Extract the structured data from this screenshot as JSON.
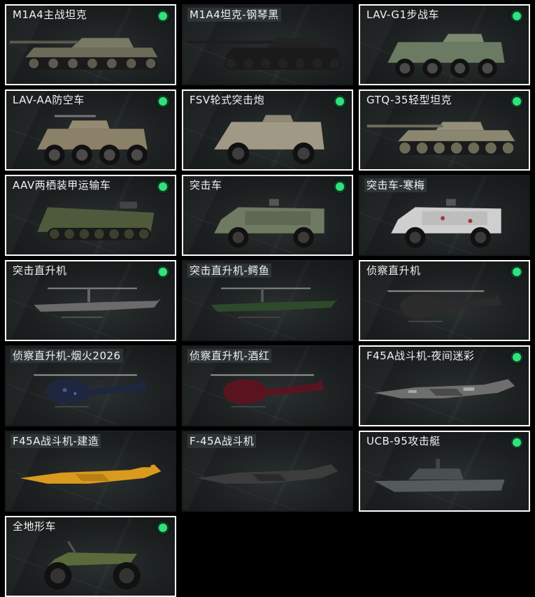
{
  "colors": {
    "owned_border": "#ffffff",
    "badge": "#34e07a",
    "background": "#000000",
    "card_bg": "#1b1f20"
  },
  "vehicles": [
    {
      "label": "M1A4主战坦克",
      "owned": true,
      "icon": "tank-icon"
    },
    {
      "label": "M1A4坦克-钢琴黑",
      "owned": false,
      "icon": "tank-black-icon"
    },
    {
      "label": "LAV-G1步战车",
      "owned": true,
      "icon": "ifv-icon"
    },
    {
      "label": "LAV-AA防空车",
      "owned": true,
      "icon": "aa-vehicle-icon"
    },
    {
      "label": "FSV轮式突击炮",
      "owned": true,
      "icon": "wheeled-assault-gun-icon"
    },
    {
      "label": "GTQ-35轻型坦克",
      "owned": true,
      "icon": "light-tank-icon"
    },
    {
      "label": "AAV两栖装甲运输车",
      "owned": true,
      "icon": "amphibious-apc-icon"
    },
    {
      "label": "突击车",
      "owned": true,
      "icon": "assault-car-icon"
    },
    {
      "label": "突击车-寒梅",
      "owned": false,
      "icon": "assault-car-plum-icon"
    },
    {
      "label": "突击直升机",
      "owned": true,
      "icon": "attack-helicopter-icon"
    },
    {
      "label": "突击直升机-鳄鱼",
      "owned": false,
      "icon": "attack-helicopter-croc-icon"
    },
    {
      "label": "侦察直升机",
      "owned": true,
      "icon": "scout-helicopter-icon"
    },
    {
      "label": "侦察直升机-烟火2026",
      "owned": false,
      "icon": "scout-helicopter-fireworks-icon"
    },
    {
      "label": "侦察直升机-酒红",
      "owned": false,
      "icon": "scout-helicopter-burgundy-icon"
    },
    {
      "label": "F45A战斗机-夜间迷彩",
      "owned": true,
      "icon": "fighter-night-camo-icon"
    },
    {
      "label": "F45A战斗机-建造",
      "owned": false,
      "icon": "fighter-construction-icon"
    },
    {
      "label": "F-45A战斗机",
      "owned": false,
      "icon": "fighter-icon"
    },
    {
      "label": "UCB-95攻击艇",
      "owned": true,
      "icon": "attack-boat-icon"
    },
    {
      "label": "全地形车",
      "owned": true,
      "icon": "atv-icon"
    }
  ]
}
